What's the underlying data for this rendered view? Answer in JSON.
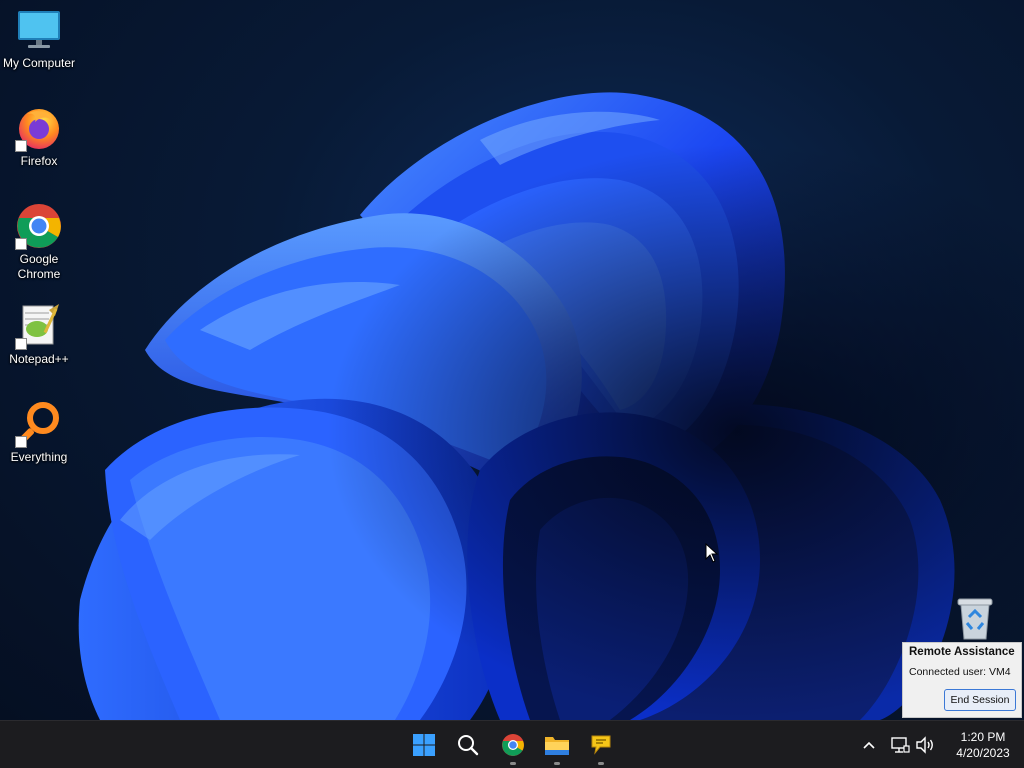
{
  "desktop": {
    "icons": [
      {
        "label": "My Computer",
        "icon": "monitor-icon"
      },
      {
        "label": "Firefox",
        "icon": "firefox-icon"
      },
      {
        "label": "Google\nChrome",
        "icon": "chrome-icon"
      },
      {
        "label": "Notepad++",
        "icon": "notepadpp-icon"
      },
      {
        "label": "Everything",
        "icon": "everything-icon"
      }
    ],
    "recycle_bin_icon": "recycle-bin-icon"
  },
  "remote_assistance": {
    "title": "Remote Assistance",
    "connected_user": "Connected user: VM4",
    "end_session_label": "End Session"
  },
  "taskbar": {
    "apps": [
      "start-icon",
      "search-icon",
      "chrome-icon",
      "file-explorer-icon",
      "remote-assistance-icon"
    ],
    "time": "1:20 PM",
    "date": "4/20/2023"
  },
  "colors": {
    "taskbar": "#1c1c1f",
    "wallpaper_blue": "#1c4dff",
    "accent": "#3b78d6"
  }
}
